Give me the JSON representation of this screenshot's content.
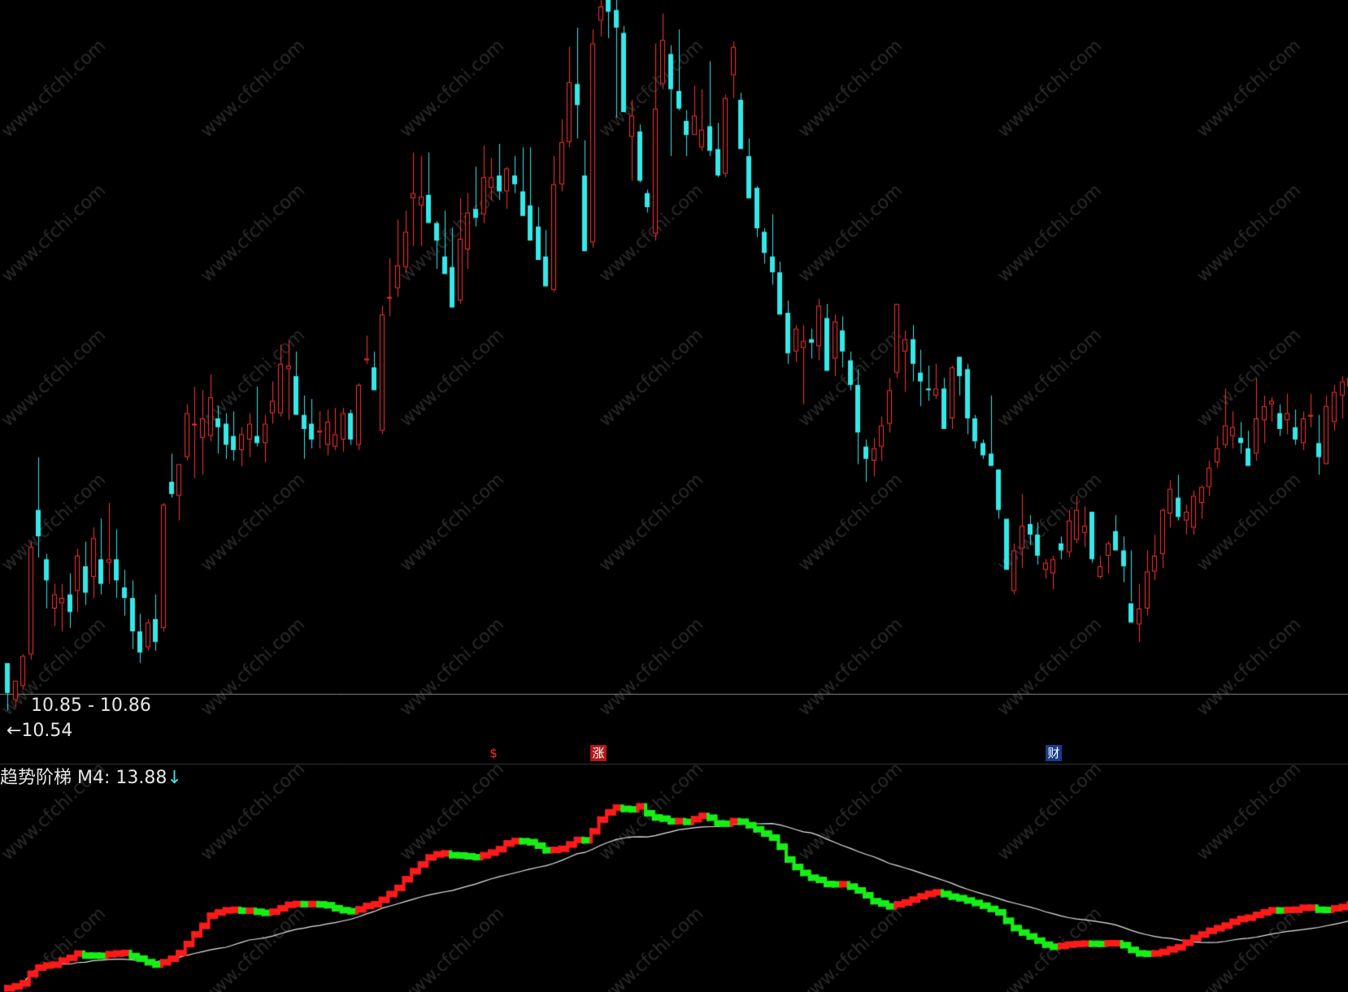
{
  "colors": {
    "up": "#ff3030",
    "down": "#35e8e8",
    "ladder_up": "#ff1a1a",
    "ladder_down": "#16ef16",
    "ma_line": "#e6e6e6",
    "background": "#000000"
  },
  "labels": {
    "price_range": "10.85 - 10.86",
    "low_price": "←10.54",
    "indicator_title": "趋势阶梯 M4: 13.88",
    "indicator_arrow": "↓",
    "markers": [
      "$",
      "涨",
      "财"
    ]
  },
  "watermark": "www.cfchi.com",
  "chart_data": [
    {
      "type": "candlestick",
      "title": "",
      "ylim": [
        10.4,
        14.6
      ],
      "columns": [
        "open",
        "high",
        "low",
        "close"
      ],
      "candles": [
        [
          10.81,
          10.81,
          10.54,
          10.64
        ],
        [
          10.6,
          10.71,
          10.56,
          10.71
        ],
        [
          10.68,
          10.86,
          10.66,
          10.85
        ],
        [
          10.86,
          11.5,
          10.83,
          11.47
        ],
        [
          11.68,
          11.98,
          11.41,
          11.53
        ],
        [
          11.4,
          11.43,
          11.12,
          11.28
        ],
        [
          11.12,
          11.26,
          11.02,
          11.2
        ],
        [
          11.15,
          11.26,
          10.99,
          11.18
        ],
        [
          11.2,
          11.32,
          11.01,
          11.1
        ],
        [
          11.22,
          11.46,
          11.1,
          11.42
        ],
        [
          11.36,
          11.5,
          11.14,
          11.21
        ],
        [
          11.3,
          11.58,
          11.18,
          11.52
        ],
        [
          11.4,
          11.63,
          11.2,
          11.26
        ],
        [
          11.38,
          11.72,
          11.26,
          11.4
        ],
        [
          11.4,
          11.57,
          11.18,
          11.28
        ],
        [
          11.24,
          11.34,
          11.08,
          11.18
        ],
        [
          11.18,
          11.28,
          10.89,
          10.99
        ],
        [
          10.99,
          11.09,
          10.81,
          10.87
        ],
        [
          10.9,
          11.06,
          10.88,
          11.04
        ],
        [
          11.06,
          11.2,
          10.88,
          10.93
        ],
        [
          11.01,
          11.72,
          10.99,
          11.71
        ],
        [
          11.84,
          12.0,
          11.75,
          11.77
        ],
        [
          11.76,
          11.9,
          11.62,
          11.94
        ],
        [
          11.98,
          12.28,
          11.96,
          12.23
        ],
        [
          12.17,
          12.38,
          11.86,
          12.17
        ],
        [
          12.09,
          12.36,
          11.88,
          12.2
        ],
        [
          12.1,
          12.45,
          12.07,
          12.32
        ],
        [
          12.2,
          12.27,
          12.0,
          12.15
        ],
        [
          12.17,
          12.23,
          11.97,
          12.05
        ],
        [
          12.1,
          12.24,
          11.96,
          12.02
        ],
        [
          12.02,
          12.15,
          11.93,
          12.11
        ],
        [
          12.08,
          12.23,
          11.98,
          12.17
        ],
        [
          12.1,
          12.38,
          12.04,
          12.06
        ],
        [
          12.06,
          12.22,
          11.95,
          12.17
        ],
        [
          12.23,
          12.41,
          12.17,
          12.3
        ],
        [
          12.23,
          12.62,
          12.21,
          12.51
        ],
        [
          12.48,
          12.64,
          12.19,
          12.5
        ],
        [
          12.44,
          12.58,
          12.36,
          12.22
        ],
        [
          12.22,
          12.33,
          11.97,
          12.14
        ],
        [
          12.17,
          12.31,
          12.03,
          12.08
        ],
        [
          12.12,
          12.24,
          12.03,
          12.13
        ],
        [
          12.05,
          12.25,
          11.99,
          12.18
        ],
        [
          12.04,
          12.26,
          12.02,
          12.11
        ],
        [
          12.08,
          12.26,
          12.01,
          12.23
        ],
        [
          12.23,
          12.25,
          12.05,
          12.08
        ],
        [
          12.05,
          12.4,
          12.02,
          12.39
        ],
        [
          12.53,
          12.67,
          12.51,
          12.54
        ],
        [
          12.49,
          12.58,
          12.42,
          12.36
        ],
        [
          12.13,
          12.84,
          12.11,
          12.79
        ],
        [
          12.89,
          13.11,
          12.78,
          12.89
        ],
        [
          12.94,
          13.33,
          12.89,
          13.07
        ],
        [
          13.06,
          13.38,
          13.03,
          13.26
        ],
        [
          13.45,
          13.71,
          13.18,
          13.48
        ],
        [
          13.41,
          13.69,
          13.18,
          13.46
        ],
        [
          13.47,
          13.71,
          13.45,
          13.31
        ],
        [
          13.31,
          13.32,
          13.05,
          13.21
        ],
        [
          13.12,
          13.38,
          13.06,
          13.02
        ],
        [
          13.06,
          13.28,
          12.96,
          12.83
        ],
        [
          12.87,
          13.45,
          12.85,
          13.22
        ],
        [
          13.16,
          13.48,
          13.05,
          13.37
        ],
        [
          13.39,
          13.63,
          13.29,
          13.34
        ],
        [
          13.36,
          13.75,
          13.31,
          13.57
        ],
        [
          13.51,
          13.68,
          13.44,
          13.57
        ],
        [
          13.58,
          13.76,
          13.44,
          13.49
        ],
        [
          13.49,
          13.63,
          13.39,
          13.62
        ],
        [
          13.58,
          13.69,
          13.48,
          13.53
        ],
        [
          13.49,
          13.74,
          13.37,
          13.35
        ],
        [
          13.41,
          13.74,
          13.28,
          13.21
        ],
        [
          13.29,
          13.4,
          13.13,
          13.1
        ],
        [
          13.12,
          13.27,
          12.98,
          12.95
        ],
        [
          12.93,
          13.69,
          12.92,
          13.53
        ],
        [
          13.53,
          13.9,
          13.49,
          13.77
        ],
        [
          13.77,
          14.31,
          13.74,
          14.11
        ],
        [
          14.1,
          14.42,
          13.79,
          13.98
        ],
        [
          13.58,
          13.78,
          13.15,
          13.15
        ],
        [
          13.2,
          14.41,
          13.17,
          14.33
        ],
        [
          14.46,
          14.84,
          14.37,
          14.54
        ],
        [
          14.59,
          14.56,
          14.36,
          14.51
        ],
        [
          14.52,
          14.66,
          13.91,
          14.42
        ],
        [
          14.39,
          14.43,
          14.06,
          13.94
        ],
        [
          13.8,
          14.01,
          13.55,
          13.92
        ],
        [
          13.83,
          13.87,
          13.54,
          13.55
        ],
        [
          13.48,
          13.5,
          13.37,
          13.4
        ],
        [
          13.25,
          14.33,
          13.21,
          13.96
        ],
        [
          14.1,
          14.5,
          14.07,
          14.35
        ],
        [
          14.27,
          14.32,
          13.69,
          14.07
        ],
        [
          14.06,
          14.41,
          13.95,
          13.96
        ],
        [
          13.89,
          13.95,
          13.69,
          13.81
        ],
        [
          13.81,
          14.09,
          13.86,
          13.92
        ],
        [
          13.74,
          14.07,
          13.72,
          13.84
        ],
        [
          13.86,
          14.23,
          13.69,
          13.72
        ],
        [
          13.73,
          13.88,
          13.57,
          13.58
        ],
        [
          13.59,
          14.04,
          13.57,
          14.02
        ],
        [
          14.15,
          14.34,
          14.02,
          14.31
        ],
        [
          14.01,
          14.05,
          13.74,
          13.73
        ],
        [
          13.69,
          13.79,
          13.46,
          13.45
        ],
        [
          13.51,
          13.52,
          13.23,
          13.28
        ],
        [
          13.26,
          13.28,
          13.08,
          13.14
        ],
        [
          13.12,
          13.36,
          12.96,
          13.03
        ],
        [
          13.03,
          13.09,
          12.8,
          12.79
        ],
        [
          12.8,
          12.87,
          12.51,
          12.57
        ],
        [
          12.58,
          12.73,
          12.52,
          12.71
        ],
        [
          12.6,
          12.73,
          12.28,
          12.64
        ],
        [
          12.65,
          12.71,
          12.54,
          12.63
        ],
        [
          12.61,
          12.88,
          12.53,
          12.84
        ],
        [
          12.77,
          12.85,
          12.48,
          12.47
        ],
        [
          12.54,
          12.79,
          12.44,
          12.75
        ],
        [
          12.7,
          12.78,
          12.49,
          12.58
        ],
        [
          12.53,
          12.58,
          12.36,
          12.39
        ],
        [
          12.39,
          12.48,
          11.94,
          12.12
        ],
        [
          12.04,
          12.08,
          11.84,
          11.97
        ],
        [
          11.96,
          12.09,
          11.87,
          12.03
        ],
        [
          12.04,
          12.21,
          11.96,
          12.16
        ],
        [
          12.17,
          12.43,
          12.12,
          12.36
        ],
        [
          12.46,
          12.84,
          12.43,
          12.85
        ],
        [
          12.58,
          12.7,
          12.35,
          12.65
        ],
        [
          12.65,
          12.73,
          12.41,
          12.51
        ],
        [
          12.46,
          12.59,
          12.27,
          12.41
        ],
        [
          12.37,
          12.5,
          12.3,
          12.36
        ],
        [
          12.33,
          12.51,
          12.31,
          12.37
        ],
        [
          12.37,
          12.43,
          12.15,
          12.14
        ],
        [
          12.2,
          12.5,
          12.14,
          12.49
        ],
        [
          12.55,
          12.55,
          12.33,
          12.44
        ],
        [
          12.48,
          12.51,
          12.11,
          12.2
        ],
        [
          12.2,
          12.22,
          12.03,
          12.07
        ],
        [
          12.06,
          12.08,
          11.97,
          11.99
        ],
        [
          12.0,
          12.33,
          11.94,
          11.93
        ],
        [
          11.91,
          11.91,
          11.63,
          11.68
        ],
        [
          11.63,
          11.62,
          11.36,
          11.34
        ],
        [
          11.22,
          11.49,
          11.2,
          11.45
        ],
        [
          11.46,
          11.77,
          11.35,
          11.59
        ],
        [
          11.6,
          11.65,
          11.48,
          11.54
        ],
        [
          11.54,
          11.61,
          11.37,
          11.42
        ],
        [
          11.34,
          11.4,
          11.29,
          11.38
        ],
        [
          11.32,
          11.42,
          11.23,
          11.4
        ],
        [
          11.49,
          11.53,
          11.4,
          11.45
        ],
        [
          11.44,
          11.68,
          11.41,
          11.62
        ],
        [
          11.51,
          11.76,
          11.49,
          11.68
        ],
        [
          11.55,
          11.7,
          11.47,
          11.59
        ],
        [
          11.67,
          11.54,
          11.38,
          11.4
        ],
        [
          11.3,
          11.42,
          11.29,
          11.36
        ],
        [
          11.42,
          11.5,
          11.32,
          11.49
        ],
        [
          11.56,
          11.65,
          11.51,
          11.45
        ],
        [
          11.45,
          11.53,
          11.27,
          11.36
        ],
        [
          11.15,
          11.45,
          11.16,
          11.04
        ],
        [
          11.03,
          11.26,
          10.93,
          11.12
        ],
        [
          11.12,
          11.45,
          11.08,
          11.33
        ],
        [
          11.33,
          11.54,
          11.28,
          11.42
        ],
        [
          11.43,
          11.69,
          11.35,
          11.68
        ],
        [
          11.66,
          11.85,
          11.58,
          11.8
        ],
        [
          11.75,
          11.88,
          11.62,
          11.64
        ],
        [
          11.62,
          11.71,
          11.54,
          11.67
        ],
        [
          11.58,
          11.79,
          11.54,
          11.76
        ],
        [
          11.72,
          11.82,
          11.63,
          11.81
        ],
        [
          11.81,
          11.96,
          11.76,
          11.92
        ],
        [
          11.95,
          12.1,
          11.92,
          12.03
        ],
        [
          12.05,
          12.37,
          12.03,
          12.16
        ],
        [
          12.1,
          12.24,
          12.03,
          12.15
        ],
        [
          12.09,
          12.18,
          12.0,
          12.06
        ],
        [
          12.03,
          12.13,
          11.94,
          11.93
        ],
        [
          12.0,
          12.43,
          11.96,
          12.2
        ],
        [
          12.19,
          12.33,
          12.06,
          12.27
        ],
        [
          12.28,
          12.32,
          12.18,
          12.3
        ],
        [
          12.23,
          12.28,
          12.1,
          12.14
        ],
        [
          12.19,
          12.34,
          12.11,
          12.23
        ],
        [
          12.15,
          12.25,
          12.05,
          12.08
        ],
        [
          12.06,
          12.24,
          12.02,
          12.2
        ],
        [
          12.21,
          12.34,
          12.15,
          12.22
        ],
        [
          12.06,
          12.22,
          11.88,
          11.98
        ],
        [
          11.94,
          12.33,
          11.94,
          12.27
        ],
        [
          12.18,
          12.39,
          12.13,
          12.35
        ],
        [
          12.33,
          12.44,
          12.2,
          12.41
        ],
        [
          12.38,
          12.56,
          12.33,
          12.43
        ],
        [
          12.48,
          12.73,
          12.45,
          12.71
        ],
        [
          12.73,
          12.78,
          12.57,
          12.61
        ],
        [
          12.57,
          12.95,
          12.55,
          12.94
        ],
        [
          12.94,
          13.07,
          12.86,
          13.02
        ],
        [
          12.99,
          13.01,
          12.78,
          12.82
        ],
        [
          12.8,
          13.06,
          12.77,
          13.01
        ],
        [
          12.93,
          13.09,
          12.89,
          12.96
        ],
        [
          12.96,
          13.1,
          12.7,
          12.68
        ],
        [
          12.68,
          12.8,
          12.6,
          12.55
        ],
        [
          12.54,
          12.66,
          12.52,
          12.62
        ],
        [
          12.52,
          12.59,
          12.43,
          12.41
        ]
      ],
      "volume_note": "",
      "price_labels": [
        "10.85 - 10.86",
        "←10.54"
      ]
    },
    {
      "type": "line",
      "title": "趋势阶梯 M4: 13.88",
      "ylim": [
        10.4,
        14.6
      ],
      "series": [
        {
          "name": "趋势阶梯",
          "values": []
        },
        {
          "name": "M4",
          "values": []
        }
      ]
    }
  ]
}
